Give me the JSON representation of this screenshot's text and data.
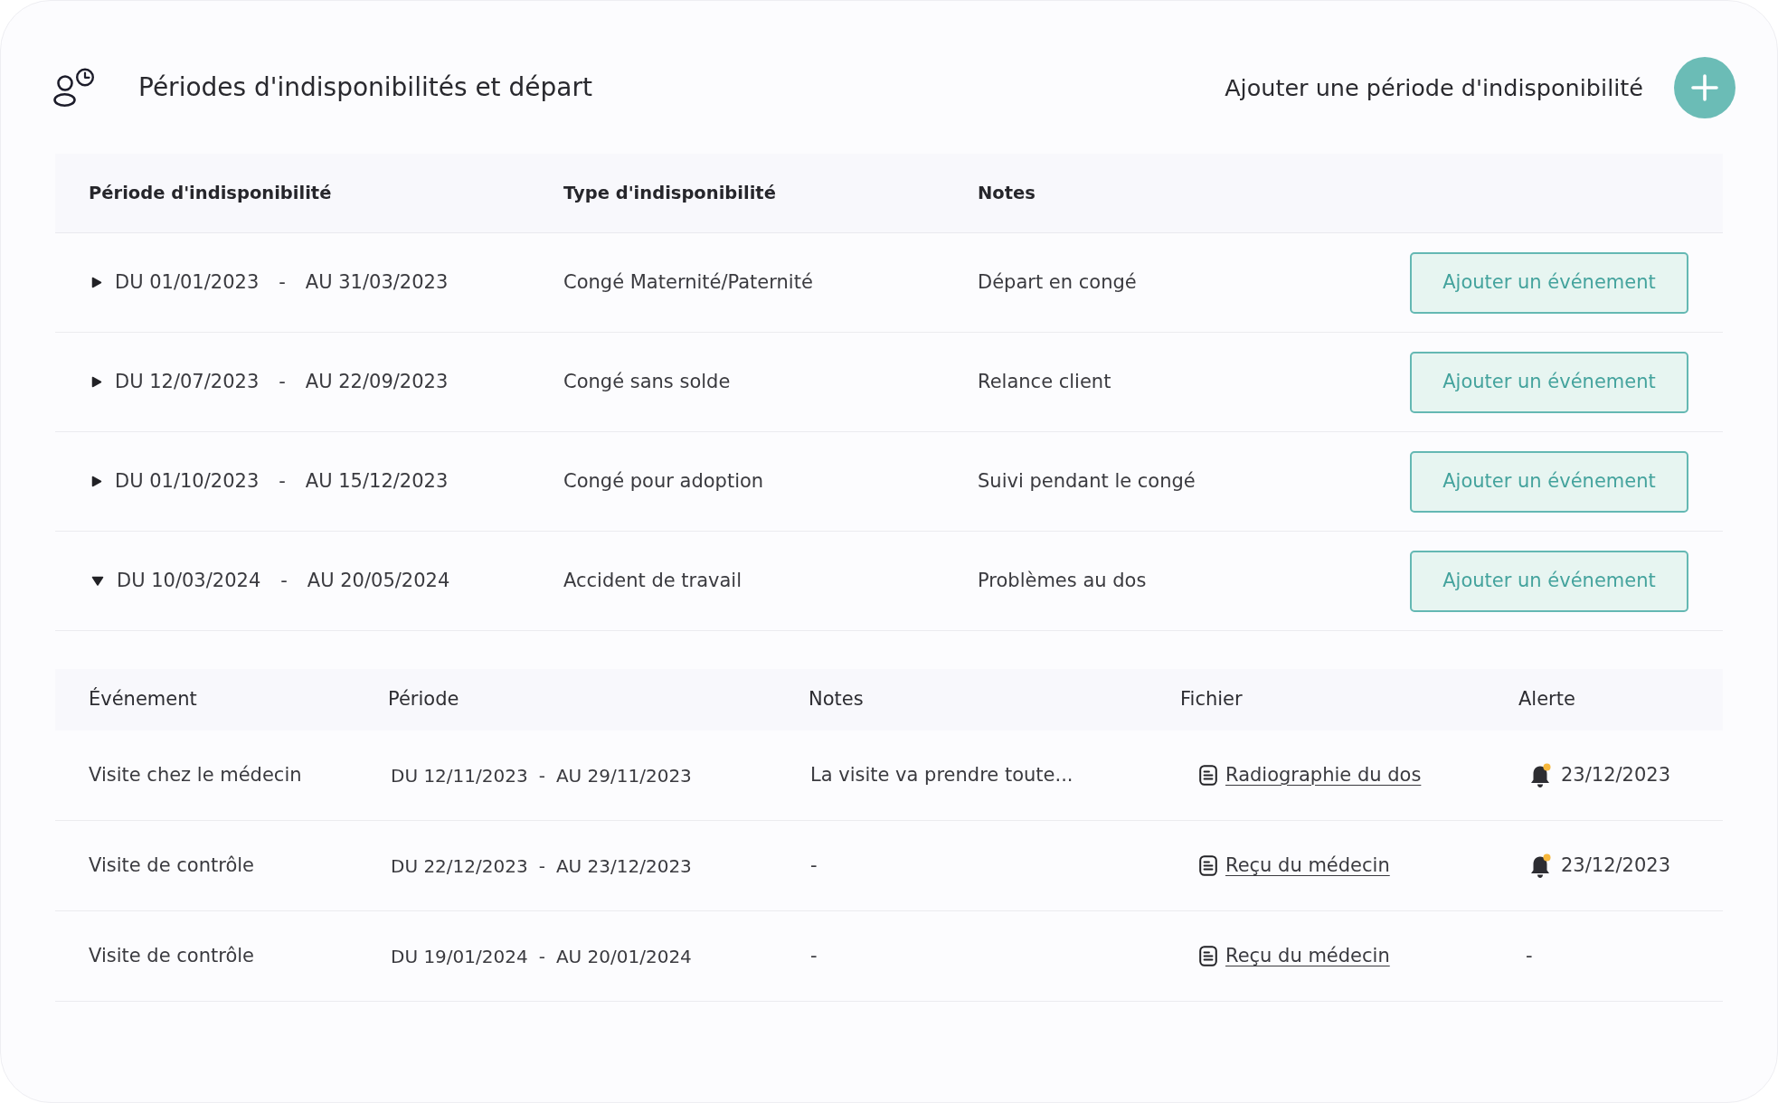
{
  "header": {
    "title": "Périodes d'indisponibilités et départ",
    "add_label": "Ajouter une période d'indisponibilité"
  },
  "periods": {
    "columns": [
      "Période d'indisponibilité",
      "Type d'indisponibilité",
      "Notes"
    ],
    "rows": [
      {
        "expanded": false,
        "start": "DU 01/01/2023",
        "separator": "-",
        "end": "AU 31/03/2023",
        "type": "Congé Maternité/Paternité",
        "notes": "Départ en congé",
        "action": "Ajouter un événement"
      },
      {
        "expanded": false,
        "start": "DU 12/07/2023",
        "separator": "-",
        "end": "AU 22/09/2023",
        "type": "Congé sans solde",
        "notes": "Relance client",
        "action": "Ajouter un événement"
      },
      {
        "expanded": false,
        "start": "DU 01/10/2023",
        "separator": "-",
        "end": "AU 15/12/2023",
        "type": "Congé pour adoption",
        "notes": "Suivi pendant le congé",
        "action": "Ajouter un événement"
      },
      {
        "expanded": true,
        "start": "DU 10/03/2024",
        "separator": "-",
        "end": "AU 20/05/2024",
        "type": "Accident de travail",
        "notes": "Problèmes au dos",
        "action": "Ajouter un événement",
        "events": {
          "columns": [
            "Événement",
            "Période",
            "Notes",
            "Fichier",
            "Alerte"
          ],
          "rows": [
            {
              "event": "Visite chez le médecin",
              "start": "DU 12/11/2023",
              "separator": "-",
              "end": "AU 29/11/2023",
              "notes": "La visite va prendre toute...",
              "file": "Radiographie du dos",
              "alert": {
                "kind": "bell",
                "text": "23/12/2023"
              }
            },
            {
              "event": "Visite de contrôle",
              "start": "DU 22/12/2023",
              "separator": "-",
              "end": "AU 23/12/2023",
              "notes": "-",
              "file": "Reçu du médecin",
              "alert": {
                "kind": "bell",
                "text": "23/12/2023"
              }
            },
            {
              "event": "Visite de contrôle",
              "start": "DU 19/01/2024",
              "separator": "-",
              "end": "AU 20/01/2024",
              "notes": "-",
              "file": "Reçu du médecin",
              "alert": {
                "kind": "none",
                "text": "-"
              }
            }
          ]
        }
      }
    ]
  }
}
